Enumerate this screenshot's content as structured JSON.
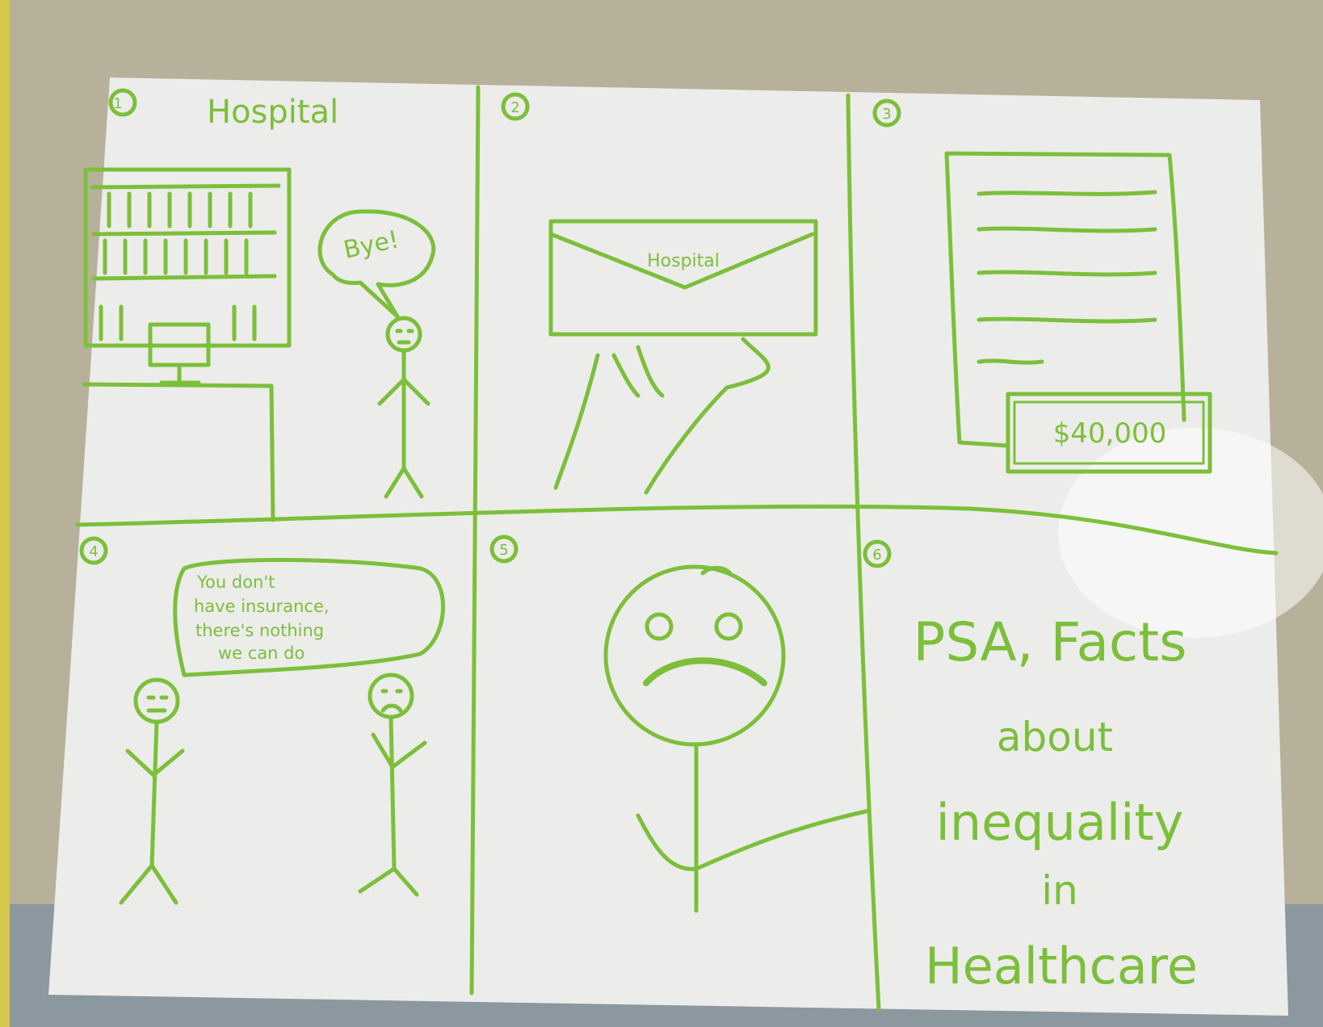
{
  "ink_color": "#7cbf3a",
  "paper_color": "#ececea",
  "panel_numbers": [
    "1",
    "2",
    "3",
    "4",
    "5",
    "6"
  ],
  "panel1": {
    "title": "Hospital",
    "speech": "Bye!"
  },
  "panel2": {
    "envelope_label": "Hospital"
  },
  "panel3": {
    "bill_amount": "$40,000"
  },
  "panel4": {
    "speech_lines": [
      "You don't",
      "have insurance,",
      "there's nothing",
      "we can do"
    ]
  },
  "panel6": {
    "title_lines": [
      "PSA, Facts",
      "about",
      "inequality",
      "in",
      "Healthcare"
    ]
  }
}
